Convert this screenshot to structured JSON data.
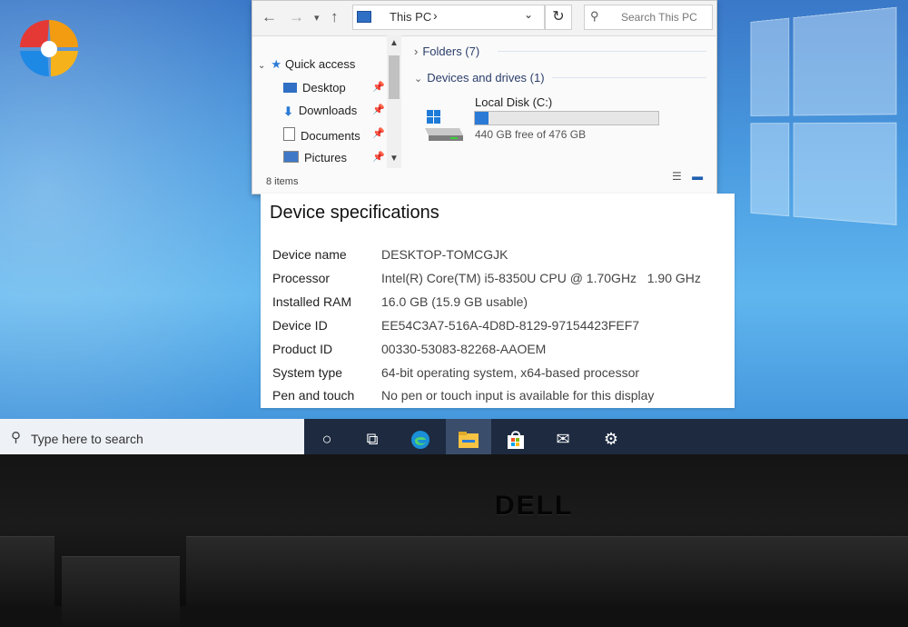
{
  "explorer": {
    "address_text": "This PC",
    "search_placeholder": "Search This PC",
    "nav": {
      "quick_access": "Quick access",
      "items": [
        {
          "label": "Desktop",
          "icon": "desktop-folder-icon"
        },
        {
          "label": "Downloads",
          "icon": "download-arrow-icon"
        },
        {
          "label": "Documents",
          "icon": "document-icon"
        },
        {
          "label": "Pictures",
          "icon": "pictures-icon"
        }
      ]
    },
    "groups": {
      "folders": "Folders (7)",
      "devices": "Devices and drives (1)"
    },
    "drive": {
      "name": "Local Disk (C:)",
      "free_text": "440 GB free of 476 GB",
      "used_fraction": 0.076
    },
    "status": "8 items"
  },
  "specs": {
    "title": "Device specifications",
    "rows": [
      {
        "key": "Device name",
        "value": "DESKTOP-TOMCGJK"
      },
      {
        "key": "Processor",
        "value": "Intel(R) Core(TM) i5-8350U CPU @ 1.70GHz   1.90 GHz"
      },
      {
        "key": "Installed RAM",
        "value": "16.0 GB (15.9 GB usable)"
      },
      {
        "key": "Device ID",
        "value": "EE54C3A7-516A-4D8D-8129-97154423FEF7"
      },
      {
        "key": "Product ID",
        "value": "00330-53083-82268-AAOEM"
      },
      {
        "key": "System type",
        "value": "64-bit operating system, x64-based processor"
      },
      {
        "key": "Pen and touch",
        "value": "No pen or touch input is available for this display"
      }
    ]
  },
  "taskbar": {
    "search_placeholder": "Type here to search",
    "apps": [
      "cortana-circle-icon",
      "task-view-icon",
      "edge-icon",
      "file-explorer-icon",
      "store-icon",
      "mail-icon",
      "settings-gear-icon"
    ],
    "active_app": "file-explorer-icon"
  },
  "brand": "DELL",
  "colors": {
    "accent": "#2b7bd6",
    "taskbar": "#1d2a40",
    "desktop": "#4a9be0"
  }
}
